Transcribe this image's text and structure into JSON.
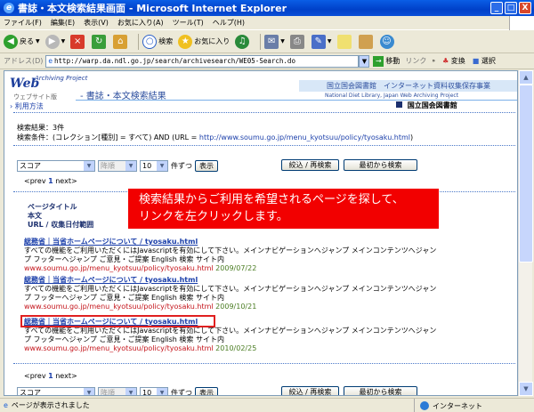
{
  "window": {
    "title": "書誌・本文検索結果画面 - Microsoft Internet Explorer",
    "minimize": "_",
    "maximize": "□",
    "close": "X"
  },
  "menubar": [
    "ファイル(F)",
    "編集(E)",
    "表示(V)",
    "お気に入り(A)",
    "ツール(T)",
    "ヘルプ(H)"
  ],
  "toolbar": {
    "back": "戻る",
    "search": "検索",
    "favorites": "お気に入り"
  },
  "address": {
    "label": "アドレス(D)",
    "url": "http://warp.da.ndl.go.jp/search/archivesearch/WE05-Search.do",
    "go": "移動",
    "links": "リンク",
    "convert": "変換",
    "select": "選択"
  },
  "page": {
    "logo": "Web",
    "logo_sup": "Archiving Project",
    "logo_sub": "ウェブサイト版",
    "page_title": "書誌・本文検索結果",
    "ndl_banner": "国立国会図書館　インターネット資料収集保存事業",
    "ndl_banner_en": "National Diet Library, Japan Web Archiving Project",
    "usage_link": "利用方法",
    "ndl_name": "国立国会図書館",
    "result_count": "検索結果：3件",
    "condition_prefix": "検索条件：(コレクション[種別] = すべて) AND (URL = ",
    "condition_url": "http://www.soumu.go.jp/menu_kyotsuu/policy/tyosaku.html",
    "condition_suffix": ")",
    "sort_select": "スコア",
    "order_select": "降順",
    "per_page_select": "10",
    "per_page_label": "件ずつ",
    "display_button": "表示",
    "refine_button": "絞込 / 再検索",
    "restart_button": "最初から検索",
    "pager_prev": "<prev",
    "pager_current": "1",
    "pager_next": "next>",
    "header_title": "ページタイトル",
    "header_body": "本文",
    "header_url": "URL / 収集日付範囲"
  },
  "results": [
    {
      "title": "総務省｜当省ホームページについて / tyosaku.html",
      "body1": "すべての機能をご利用いただくにはJavascriptを有効にして下さい。メインナビゲーションへジャンプ メインコンテンツへジャン",
      "body2": "プ フッターへジャンプ ご意見・ご提案 English 検索 サイト内",
      "url": "www.soumu.go.jp/menu_kyotsuu/policy/tyosaku.html",
      "date": "2009/07/22"
    },
    {
      "title": "総務省｜当省ホームページについて / tyosaku.html",
      "body1": "すべての機能をご利用いただくにはJavascriptを有効にして下さい。メインナビゲーションへジャンプ メインコンテンツへジャン",
      "body2": "プ フッターへジャンプ ご意見・ご提案 English 検索 サイト内",
      "url": "www.soumu.go.jp/menu_kyotsuu/policy/tyosaku.html",
      "date": "2009/10/21"
    },
    {
      "title": "総務省｜当省ホームページについて / tyosaku.html",
      "body1": "すべての機能をご利用いただくにはJavascriptを有効にして下さい。メインナビゲーションへジャンプ メインコンテンツへジャン",
      "body2": "プ フッターへジャンプ ご意見・ご提案 English 検索 サイト内",
      "url": "www.soumu.go.jp/menu_kyotsuu/policy/tyosaku.html",
      "date": "2010/02/25"
    }
  ],
  "callout": {
    "line1": "検索結果からご利用を希望されるページを探して、",
    "line2": "リンクを左クリックします。"
  },
  "status": {
    "text": "ページが表示されました",
    "zone": "インターネット"
  }
}
